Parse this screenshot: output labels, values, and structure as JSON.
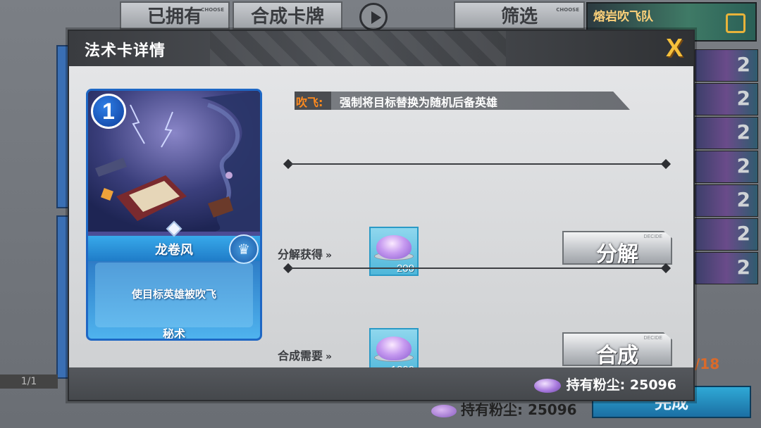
{
  "background": {
    "tabs": {
      "owned": "已拥有",
      "craft_cards": "合成卡牌",
      "filter": "筛选",
      "choose_tag": "CHOOSE"
    },
    "team_name": "熔岩吹飞队",
    "list_counts": [
      "2",
      "2",
      "2",
      "2",
      "2",
      "2",
      "2"
    ],
    "page_indicator": "1/1",
    "slot_count": "/18",
    "dust_label": "持有粉尘:",
    "dust_value": "25096",
    "done_button": "完成",
    "decide_tag": "DECIDE"
  },
  "modal": {
    "title": "法术卡详情",
    "close_label": "X",
    "card": {
      "cost": "1",
      "name": "龙卷风",
      "description": "使目标英雄被吹飞",
      "type": "秘术"
    },
    "effect": {
      "tag": "吹飞:",
      "text": "强制将目标替换为随机后备英雄"
    },
    "disenchant": {
      "label": "分解获得",
      "arrows": "»",
      "amount": "200",
      "button": "分解",
      "decide_tag": "DECIDE"
    },
    "craft": {
      "label": "合成需要",
      "arrows": "»",
      "amount": "1200",
      "button": "合成",
      "decide_tag": "DECIDE"
    },
    "footer": {
      "dust_label": "持有粉尘:",
      "dust_value": "25096"
    }
  },
  "colors": {
    "accent_orange": "#ff8a1e",
    "close_gold": "#f6c13c",
    "card_blue": "#1e67c4",
    "dust_purple": "#a778dd"
  },
  "icons": [
    "play-icon",
    "edit-icon",
    "close-icon",
    "dust-icon",
    "cost-badge",
    "emblem-icon",
    "arrows-icon"
  ]
}
